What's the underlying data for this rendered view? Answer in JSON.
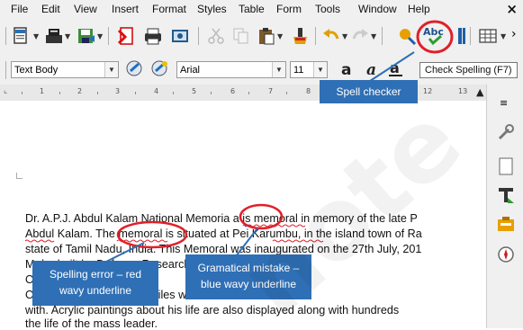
{
  "menubar": {
    "items": [
      "File",
      "Edit",
      "View",
      "Insert",
      "Format",
      "Styles",
      "Table",
      "Form",
      "Tools",
      "Window",
      "Help"
    ],
    "underline": [
      "F",
      "E",
      "V",
      "I",
      "o",
      "y",
      "a",
      "o",
      "T",
      "W",
      "H"
    ],
    "close": "×"
  },
  "toolbar": {
    "spell_icon_text": "Abc",
    "tooltip": "Check Spelling (F7)",
    "overflow": "›"
  },
  "format": {
    "paragraph_style": "Text Body",
    "font_name": "Arial",
    "font_size": "11",
    "overflow": "›"
  },
  "ruler": {
    "numbers": [
      "1",
      "2",
      "3",
      "4",
      "5",
      "6",
      "7",
      "8",
      "12",
      "13"
    ]
  },
  "document": {
    "lines": [
      "Dr. A.P.J. Abdul Kalam National Memoria a is memoral in memory of the late P",
      "Abdul Kalam. The memoral is situated at Pei Karumbu, in the island town of Ra",
      "state of Tamil Nadu, India. This Memoral was inaugurated on the 27th July, 201",
      "M                              dra                  built by Defence Research",
      "O",
      "O                         icas of rockets and missiles with which Dr. A.P.J. Abdu",
      "with. Acrylic paintings about his life are also displayed along with hundreds",
      "the life of the mass leader."
    ]
  },
  "callouts": {
    "spell_checker": "Spell checker",
    "spelling_error_1": "Spelling error – red",
    "spelling_error_2": "wavy underline",
    "grammar_1": "Gramatical mistake –",
    "grammar_2": "blue wavy underline"
  },
  "colors": {
    "callout_bg": "#2f6fb5",
    "annotation_red": "#e0202a",
    "spell_wave": "#e0202a",
    "grammar_wave": "#2060d0"
  }
}
